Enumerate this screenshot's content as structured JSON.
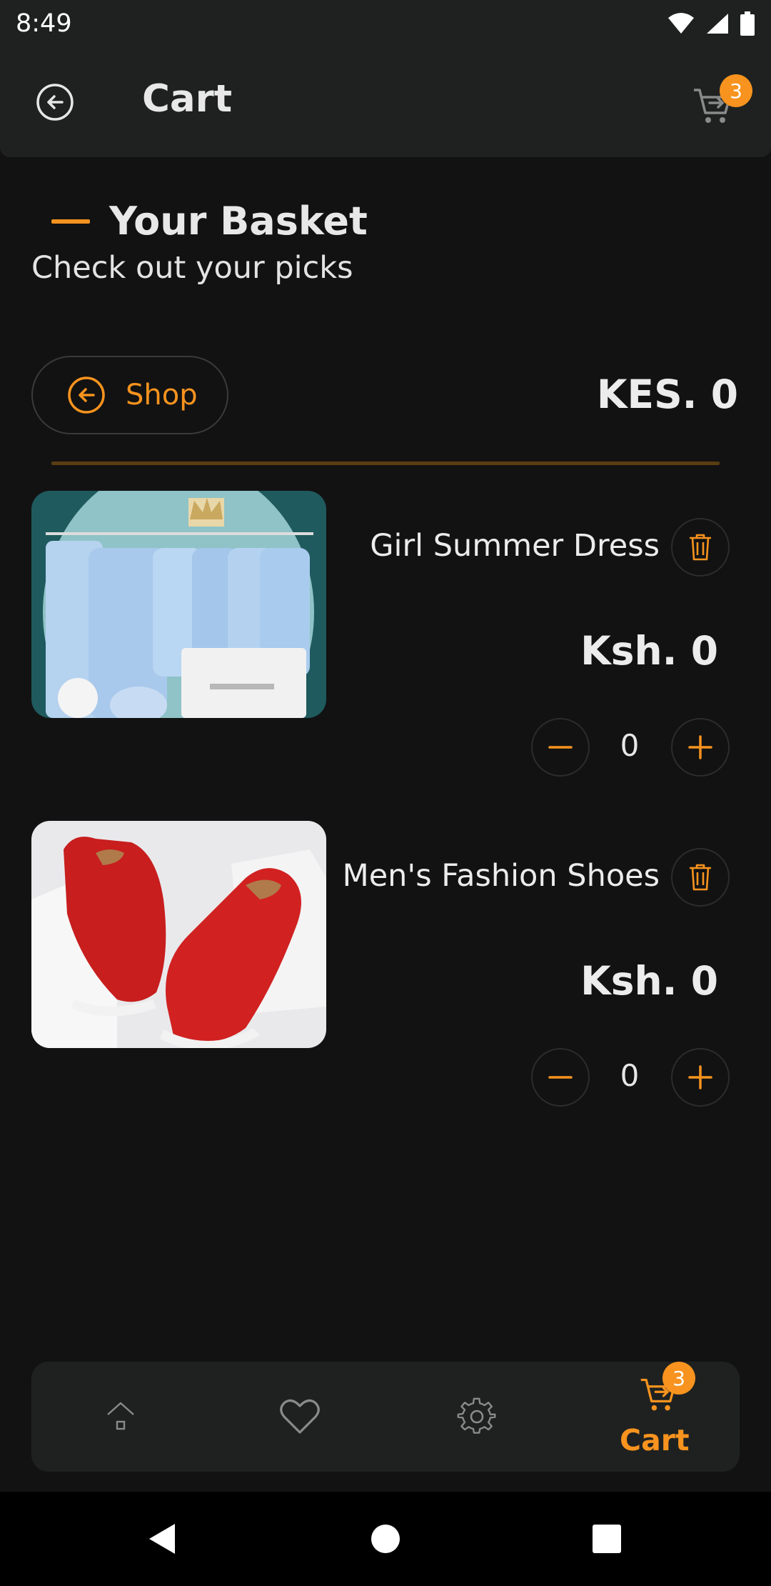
{
  "status_bar": {
    "time": "8:49"
  },
  "app_bar": {
    "title": "Cart",
    "cart_badge": "3"
  },
  "basket": {
    "title": "Your Basket",
    "subtitle": "Check out your picks"
  },
  "shop_button": {
    "label": "Shop"
  },
  "total": "KES. 0",
  "items": [
    {
      "name": "Girl Summer Dress",
      "price": "Ksh. 0",
      "quantity": "0"
    },
    {
      "name": "Men's Fashion Shoes",
      "price": "Ksh. 0",
      "quantity": "0"
    }
  ],
  "bottom_nav": {
    "items": [
      {
        "icon": "home-icon"
      },
      {
        "icon": "heart-icon"
      },
      {
        "icon": "gear-icon"
      },
      {
        "icon": "cart-icon",
        "label": "Cart",
        "badge": "3",
        "active": true
      }
    ]
  },
  "colors": {
    "accent": "#f7931e",
    "background": "#121212",
    "surface": "#1f2121"
  }
}
